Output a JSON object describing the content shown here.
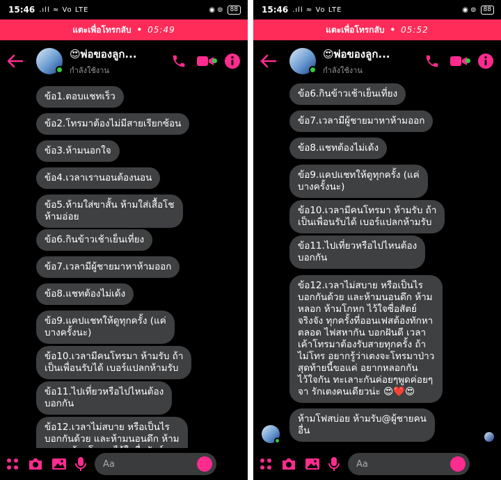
{
  "status_bar": {
    "time": "15:46",
    "signal": ".ıll ≈ Vo LTE",
    "right_icons": "◉ ⊚",
    "battery": "88"
  },
  "call_banner": {
    "label": "แตะเพื่อโทรกลับ",
    "left_time": "05:49",
    "right_time": "05:52"
  },
  "header": {
    "contact_name": "😍พ่อของลูก...",
    "contact_status": "กำลังใช้งาน",
    "accent_color": "#ff2b8f",
    "icons": [
      "back-arrow-icon",
      "phone-icon",
      "video-call-icon",
      "info-icon"
    ]
  },
  "left_messages": [
    "ข้อ1.ตอบแชทเร็ว",
    "ข้อ2.โทรมาต้องไม่มีสายเรียกซ้อน",
    "ข้อ3.ห้ามนอกใจ",
    "ข้อ4.เวลาเรานอนต้องนอน",
    "ข้อ5.ห้ามใส่ขาสั้น ห้ามใส่เสื้อโช\nห้ามอ่อย",
    "ข้อ6.กินข้าวเช้าเย็นเที่ยง",
    "ข้อ7.เวลามีผู้ชายมาหาห้ามออก",
    "ข้อ8.แชทต้องไม่เด้ง",
    "ข้อ9.แคปแชทให้ดูทุกครั้ง (แค่\nบางครั้งนะ)",
    "ข้อ10.เวลามีคนโทรมา ห้ามรับ ถ้า\nเป็นเพื่อนรับได้ เบอร์แปลกห้ามรับ",
    "ข้อ11.ไปเที่ยวหรือไปไหนต้อง\nบอกกัน",
    "ข้อ12.เวลาไม่สบาย หรือเป็นไร\nบอกกันด้วย และห้ามนอนดึก ห้าม\nหลอก ห้ามโกหก ไว้ใจซื่อสัตย์"
  ],
  "right_messages": [
    "ข้อ6.กินข้าวเช้าเย็นเที่ยง",
    "ข้อ7.เวลามีผู้ชายมาหาห้ามออก",
    "ข้อ8.แชทต้องไม่เด้ง",
    "ข้อ9.แคปแชทให้ดูทุกครั้ง (แค่\nบางครั้งนะ)",
    "ข้อ10.เวลามีคนโทรมา ห้ามรับ ถ้า\nเป็นเพื่อนรับได้ เบอร์แปลกห้ามรับ",
    "ข้อ11.ไปเที่ยวหรือไปไหนต้อง\nบอกกัน",
    "ข้อ12.เวลาไม่สบาย หรือเป็นไร\nบอกกันด้วย และห้ามนอนดึก ห้าม\nหลอก ห้ามโกหก ไว้ใจซื่อสัตย์\nจริงจัง ทุกครั้งที่ออนเฟสต้องทักหา\nตลอด ไฟสหากัน บอกฝันดี เวลา\nเค้าโทรมาต้องรับสายทุกครั้ง ถ้า\nไม่โทร อยากรู้ว่าเตงจะโทรมาป่าว\nสุดท้ายนี้ขอแค่ อยากหลอกกัน\nไว้ใจกัน ทะเลาะกันค่อยๆพูดค่อยๆ\nจา รักเตงคนเดียวน่ะ 😍❤️😍",
    "ห้ามโฟสบ่อย ห้ามรับ@ผู้ชายคน\nอื่น"
  ],
  "composer": {
    "placeholder": "Aa",
    "reaction_emoji": "😍",
    "icons": [
      "menu-dots-icon",
      "camera-icon",
      "gallery-icon",
      "microphone-icon",
      "emoji-icon"
    ]
  }
}
